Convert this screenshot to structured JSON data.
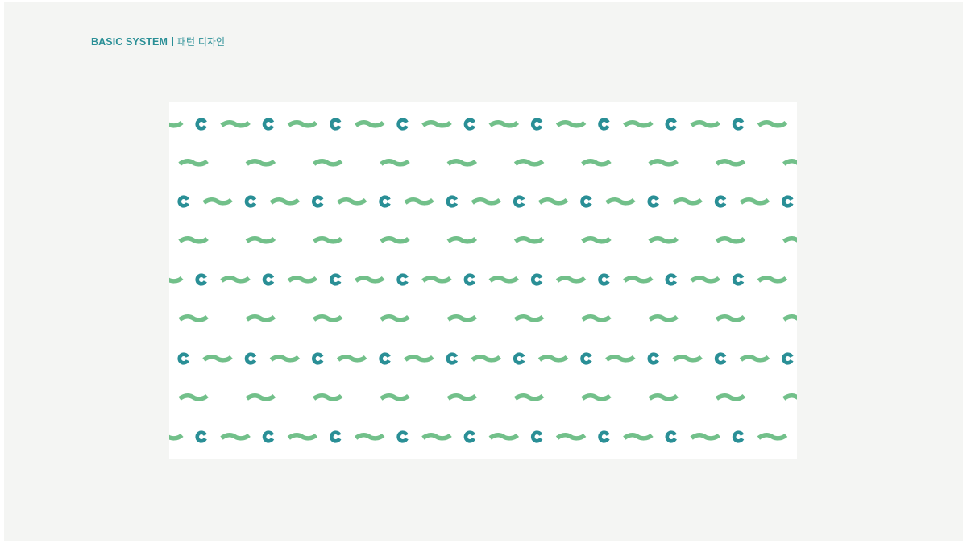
{
  "header": {
    "title": "BASIC SYSTEM",
    "subtitle": "패턴 디자인"
  },
  "pattern": {
    "motifs": [
      "c-ring-icon",
      "wave-icon"
    ],
    "colors": {
      "ring": "#2a8f96",
      "wave": "#72c08a",
      "panel": "#ffffff",
      "background": "#f4f5f3"
    }
  }
}
